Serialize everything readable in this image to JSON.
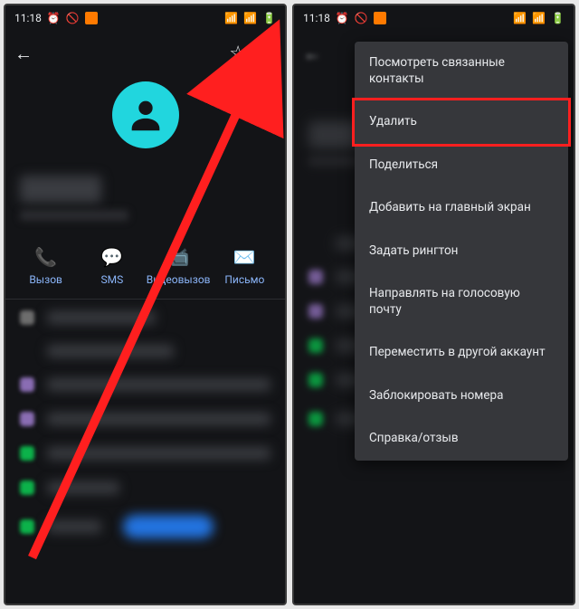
{
  "status": {
    "time": "11:18",
    "battery": "72"
  },
  "actions": {
    "call": "Вызов",
    "sms": "SMS",
    "video": "Видеовызов",
    "email": "Письмо"
  },
  "menu": {
    "view_linked": "Посмотреть связанные контакты",
    "delete": "Удалить",
    "share": "Поделиться",
    "add_home": "Добавить на главный экран",
    "set_ringtone": "Задать рингтон",
    "voicemail": "Направлять на голосовую почту",
    "move_account": "Переместить в другой аккаунт",
    "block": "Заблокировать номера",
    "help": "Справка/отзыв"
  }
}
